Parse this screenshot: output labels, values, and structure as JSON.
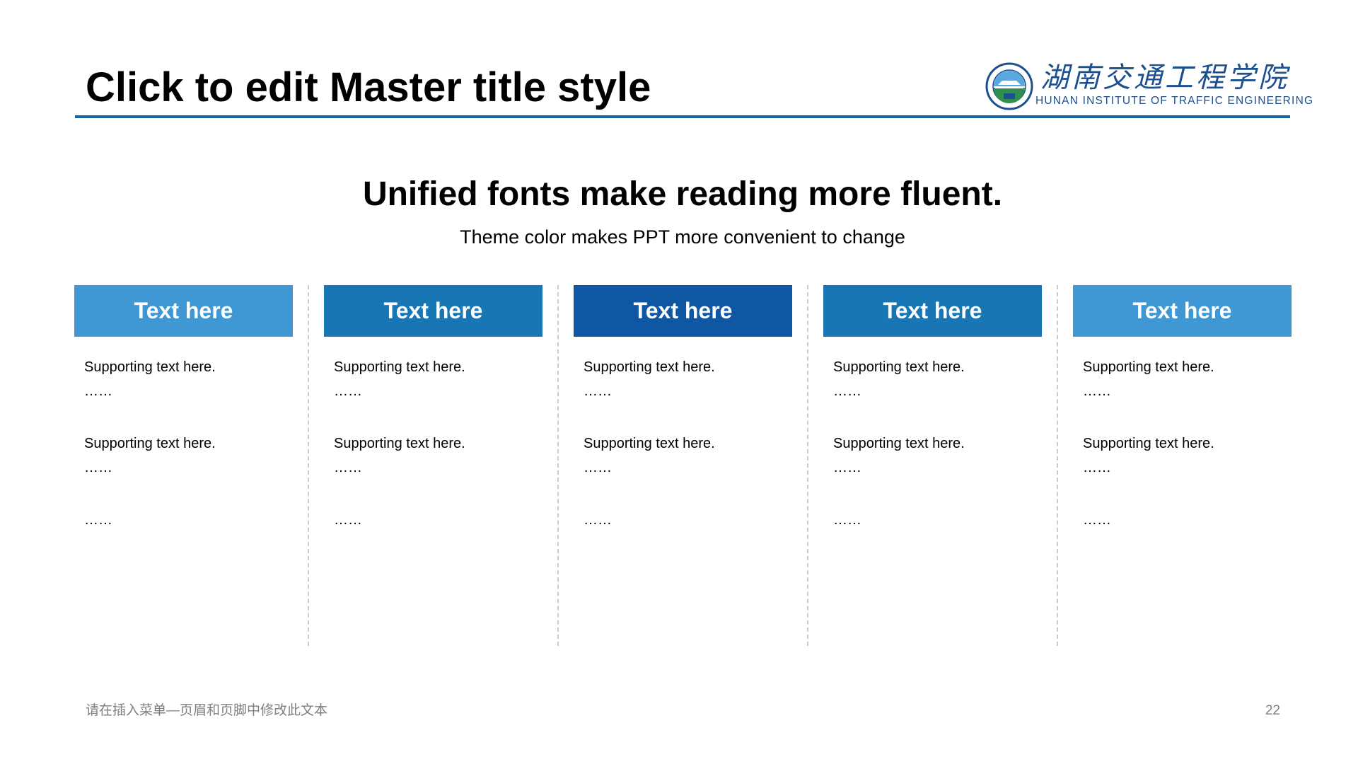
{
  "title": "Click to edit Master title style",
  "logo": {
    "name_cn": "湖南交通工程学院",
    "name_en": "HUNAN INSTITUTE OF TRAFFIC ENGINEERING"
  },
  "headline": "Unified fonts make reading more fluent.",
  "subline": "Theme color makes PPT more convenient to change",
  "columns": [
    {
      "header": "Text here",
      "color": "#3f97d4",
      "lines": [
        "Supporting  text here.",
        "……",
        "Supporting  text here.",
        "……",
        "……"
      ]
    },
    {
      "header": "Text here",
      "color": "#1976b5",
      "lines": [
        "Supporting  text here.",
        "……",
        "Supporting  text here.",
        "……",
        "……"
      ]
    },
    {
      "header": "Text here",
      "color": "#0f57a3",
      "lines": [
        "Supporting  text here.",
        "……",
        "Supporting  text here.",
        "……",
        "……"
      ]
    },
    {
      "header": "Text here",
      "color": "#1976b5",
      "lines": [
        "Supporting  text here.",
        "……",
        "Supporting  text here.",
        "……",
        "……"
      ]
    },
    {
      "header": "Text here",
      "color": "#3f97d4",
      "lines": [
        "Supporting  text here.",
        "……",
        "Supporting  text here.",
        "……",
        "……"
      ]
    }
  ],
  "footer": {
    "text": "请在插入菜单—页眉和页脚中修改此文本",
    "page_number": "22"
  },
  "colors": {
    "accent": "#1665a9",
    "logo_text": "#1b4f8f",
    "divider": "#cccccc",
    "footer": "#7f7f7f"
  }
}
